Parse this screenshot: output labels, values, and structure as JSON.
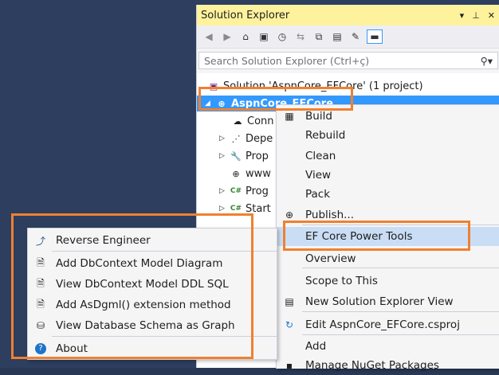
{
  "solution_explorer": {
    "title": "Solution Explorer",
    "title_controls": [
      "▾",
      "⊥",
      "✕"
    ],
    "search_placeholder": "Search Solution Explorer (Ctrl+ç)",
    "solution_label": "Solution 'AspnCore_EFCore' (1 project)",
    "project_label": "AspnCore_EFCore",
    "tree_items": [
      {
        "label": "Conn",
        "icon": "cloud-icon"
      },
      {
        "label": "Depe",
        "icon": "dependencies-icon"
      },
      {
        "label": "Prop",
        "icon": "wrench-icon"
      },
      {
        "label": "www",
        "icon": "globe-icon"
      },
      {
        "label": "Prog",
        "icon": "csharp-file-icon"
      },
      {
        "label": "Start",
        "icon": "csharp-file-icon"
      }
    ]
  },
  "project_menu": {
    "items": [
      {
        "label": "Build"
      },
      {
        "label": "Rebuild"
      },
      {
        "label": "Clean"
      },
      {
        "label": "View"
      },
      {
        "label": "Pack"
      },
      {
        "label": "Publish..."
      },
      {
        "label": "EF Core Power Tools"
      },
      {
        "label": "Overview"
      },
      {
        "label": "Scope to This"
      },
      {
        "label": "New Solution Explorer View"
      },
      {
        "label": "Edit AspnCore_EFCore.csproj"
      },
      {
        "label": "Add"
      },
      {
        "label": "Manage NuGet Packages"
      }
    ]
  },
  "ef_menu": {
    "items": [
      {
        "label": "Reverse Engineer"
      },
      {
        "label": "Add DbContext Model Diagram"
      },
      {
        "label": "View DbContext Model DDL SQL"
      },
      {
        "label": "Add AsDgml() extension method"
      },
      {
        "label": "View Database Schema as Graph"
      },
      {
        "label": "About"
      }
    ]
  },
  "colors": {
    "desktop": "#2d3e5e",
    "title_bar": "#fff29d",
    "selection": "#3399ff",
    "highlight_box": "#f08030"
  }
}
